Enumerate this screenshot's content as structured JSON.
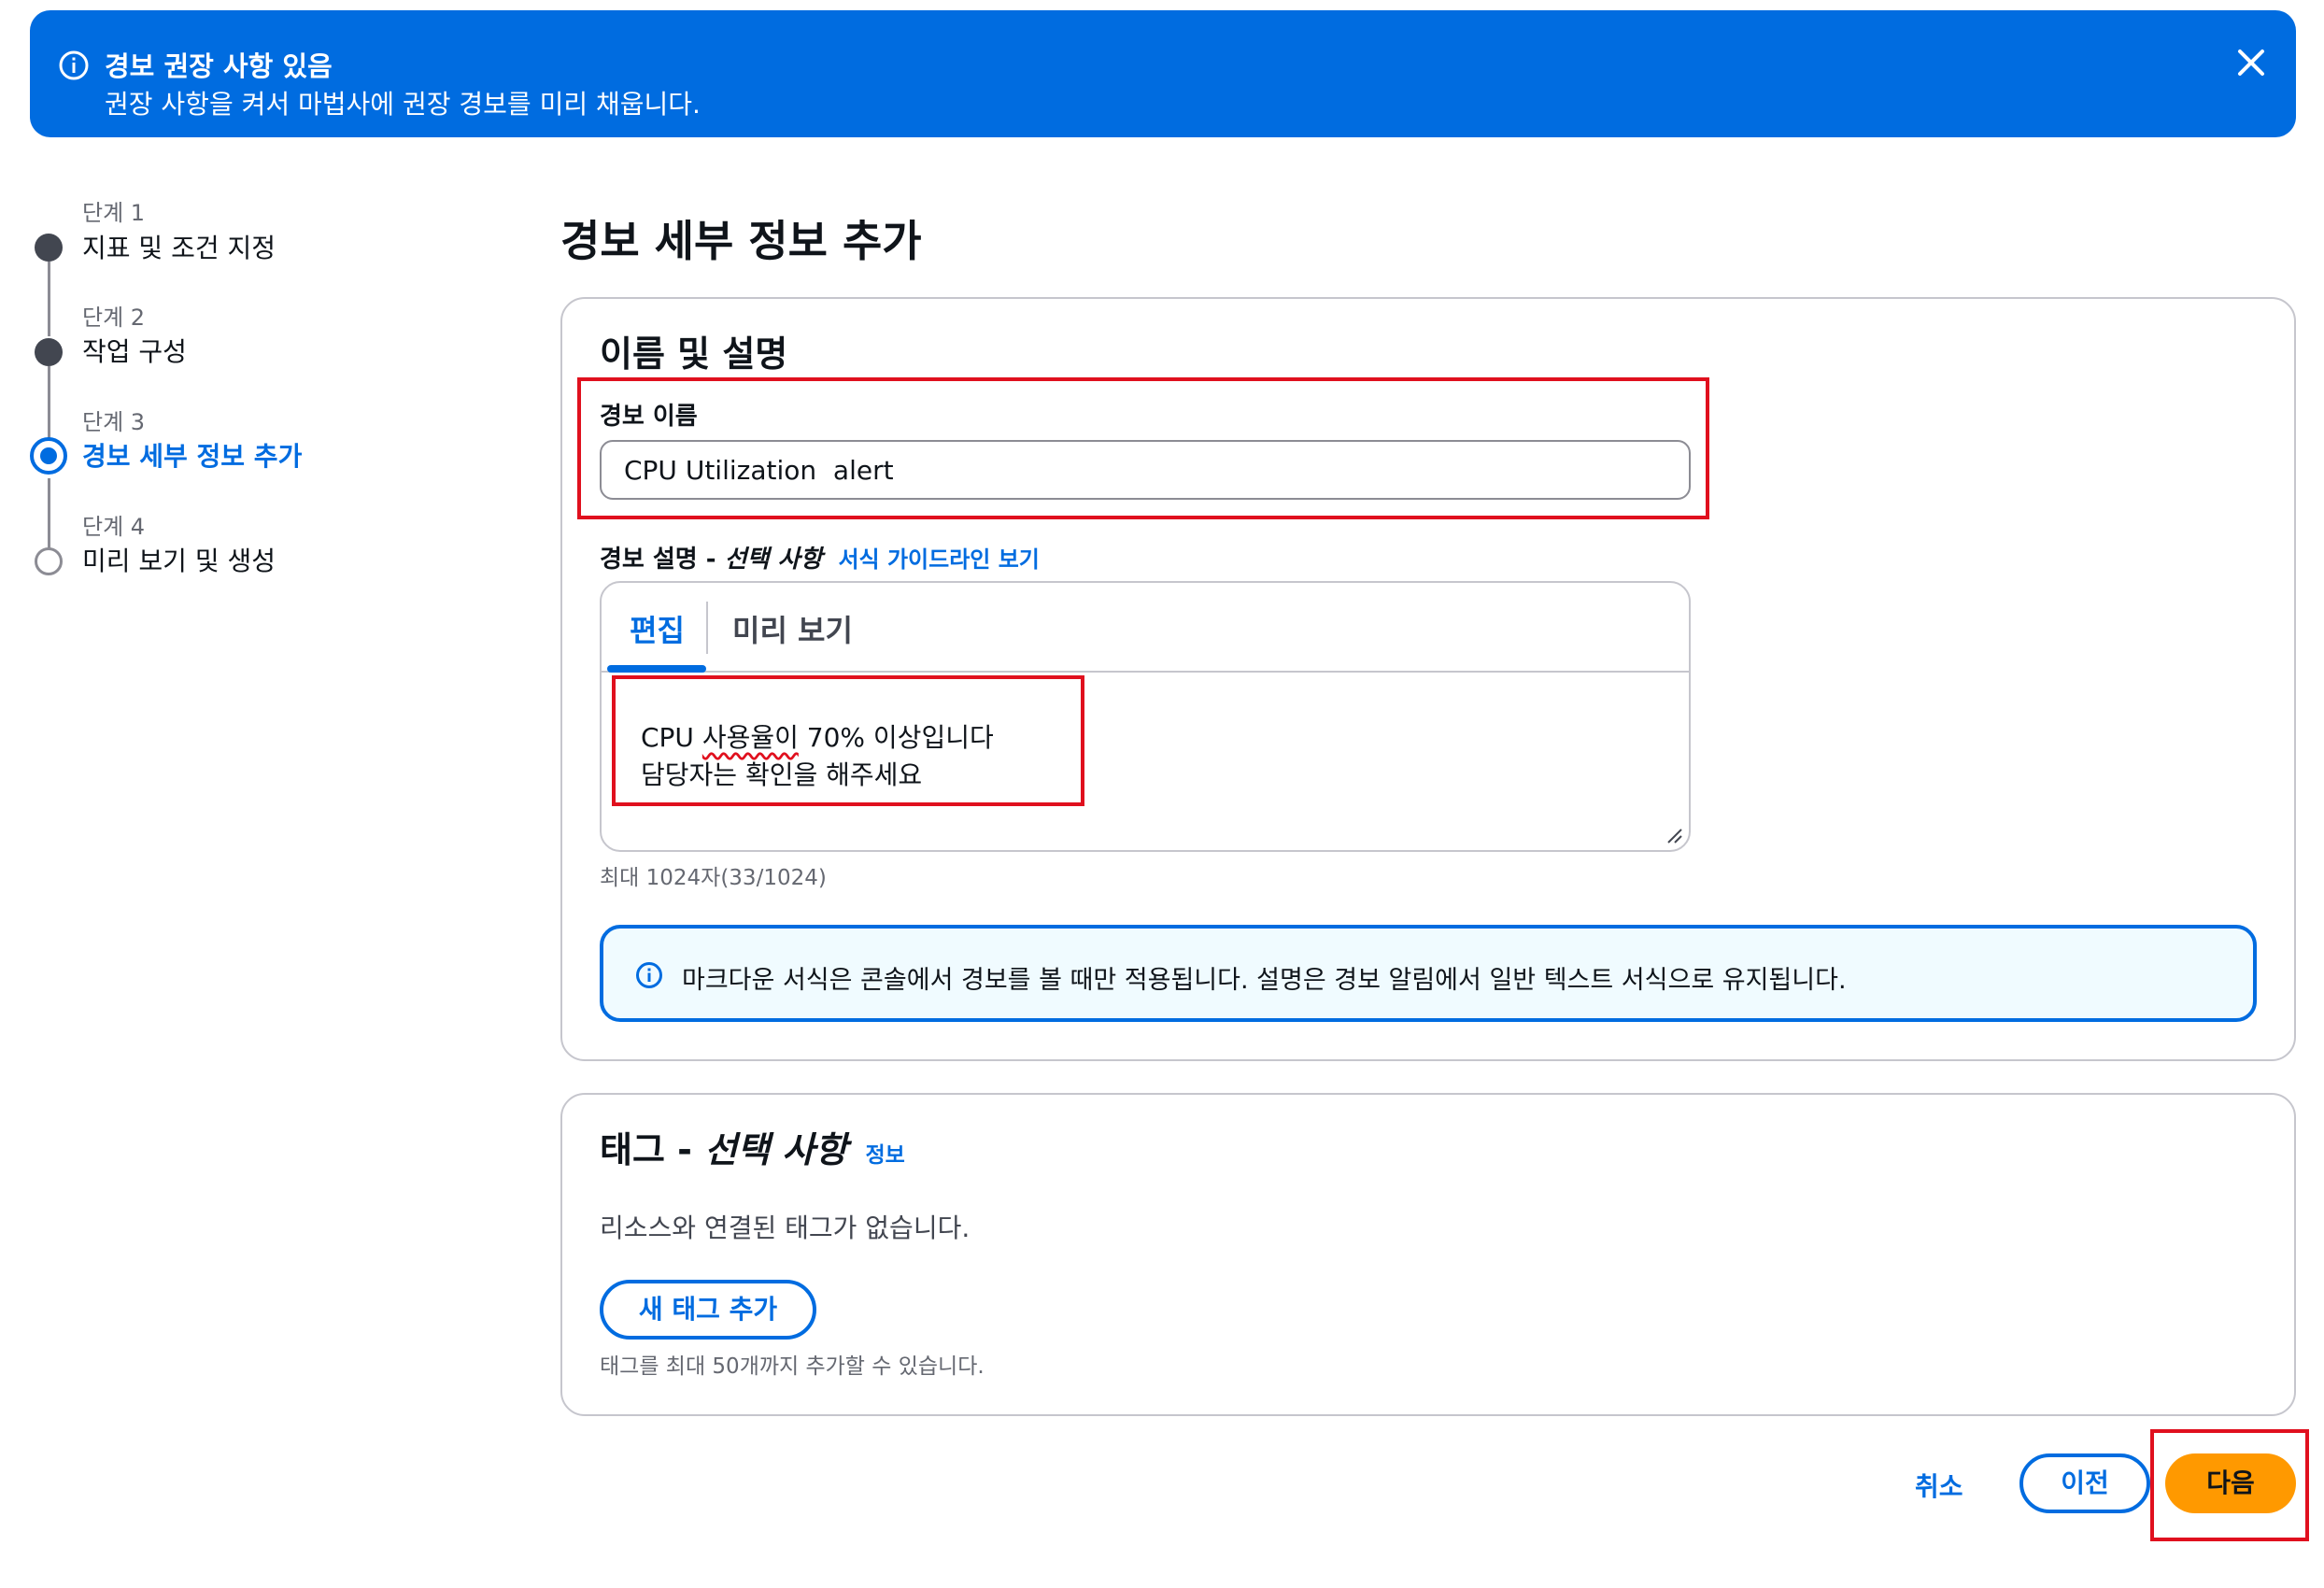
{
  "banner": {
    "title": "경보 권장 사항 있음",
    "text": "권장 사항을 켜서 마법사에 권장 경보를 미리 채웁니다."
  },
  "steps": [
    {
      "label": "단계 1",
      "title": "지표 및 조건 지정",
      "state": "done"
    },
    {
      "label": "단계 2",
      "title": "작업 구성",
      "state": "done"
    },
    {
      "label": "단계 3",
      "title": "경보 세부 정보 추가",
      "state": "current"
    },
    {
      "label": "단계 4",
      "title": "미리 보기 및 생성",
      "state": "todo"
    }
  ],
  "page_title": "경보 세부 정보 추가",
  "name_section": {
    "heading": "이름 및 설명",
    "name_label": "경보 이름",
    "name_value": "CPU Utilization  alert",
    "desc_label": "경보 설명 - ",
    "desc_optional": "선택 사항",
    "format_link": "서식 가이드라인 보기",
    "tabs": {
      "edit": "편집",
      "preview": "미리 보기"
    },
    "desc_line1_pre": "CPU ",
    "desc_line1_misspelled": "사용율이",
    "desc_line1_post": " 70% 이상입니다",
    "desc_line2": "담당자는 확인을 해주세요",
    "char_hint": "최대 1024자(33/1024)",
    "info_alert": "마크다운 서식은 콘솔에서 경보를 볼 때만 적용됩니다. 설명은 경보 알림에서 일반 텍스트 서식으로 유지됩니다."
  },
  "tags_section": {
    "heading": "태그 - ",
    "heading_optional": "선택 사항",
    "info_link": "정보",
    "empty_text": "리소스와 연결된 태그가 없습니다.",
    "add_button": "새 태그 추가",
    "limit_hint": "태그를 최대 50개까지 추가할 수 있습니다."
  },
  "footer": {
    "cancel": "취소",
    "previous": "이전",
    "next": "다음"
  },
  "colors": {
    "accent": "#006ce0",
    "primary_button": "#ff9900",
    "highlight": "#e0101e"
  }
}
